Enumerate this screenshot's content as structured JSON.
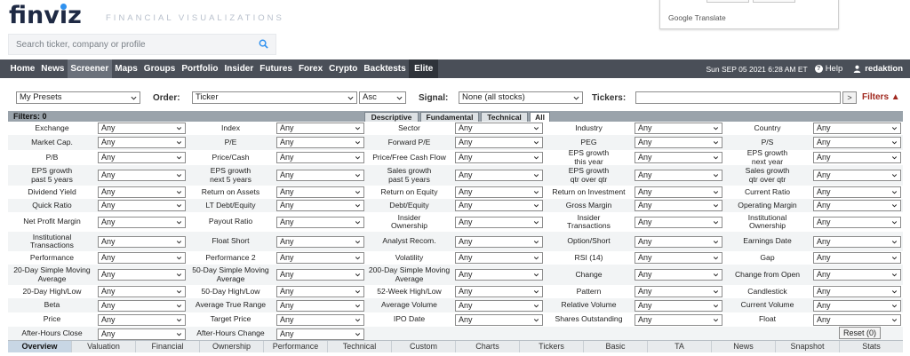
{
  "header": {
    "logo_text": "finviz",
    "tagline": "FINANCIAL VISUALIZATIONS",
    "search_placeholder": "Search ticker, company or profile",
    "translate_label": "Google Translate"
  },
  "nav": {
    "items": [
      "Home",
      "News",
      "Screener",
      "Maps",
      "Groups",
      "Portfolio",
      "Insider",
      "Futures",
      "Forex",
      "Crypto",
      "Backtests",
      "Elite"
    ],
    "active": "Screener",
    "datetime": "Sun SEP 05 2021 6:28 AM ET",
    "help": "Help",
    "user": "redaktion"
  },
  "controls": {
    "presets_value": "My Presets",
    "order_label": "Order:",
    "order_value": "Ticker",
    "direction_value": "Asc",
    "signal_label": "Signal:",
    "signal_value": "None (all stocks)",
    "tickers_label": "Tickers:",
    "go_label": ">",
    "filters_toggle": "Filters ▲"
  },
  "filter_header": {
    "count_label": "Filters: 0",
    "tabs": [
      "Descriptive",
      "Fundamental",
      "Technical",
      "All"
    ],
    "active_tab": "All"
  },
  "filter_default_value": "Any",
  "filter_rows": [
    [
      "Exchange",
      "Index",
      "Sector",
      "Industry",
      "Country"
    ],
    [
      "Market Cap.",
      "P/E",
      "Forward P/E",
      "PEG",
      "P/S"
    ],
    [
      "P/B",
      "Price/Cash",
      "Price/Free Cash Flow",
      "EPS growth\nthis year",
      "EPS growth\nnext year"
    ],
    [
      "EPS growth\npast 5 years",
      "EPS growth\nnext 5 years",
      "Sales growth\npast 5 years",
      "EPS growth\nqtr over qtr",
      "Sales growth\nqtr over qtr"
    ],
    [
      "Dividend Yield",
      "Return on Assets",
      "Return on Equity",
      "Return on Investment",
      "Current Ratio"
    ],
    [
      "Quick Ratio",
      "LT Debt/Equity",
      "Debt/Equity",
      "Gross Margin",
      "Operating Margin"
    ],
    [
      "Net Profit Margin",
      "Payout Ratio",
      "Insider\nOwnership",
      "Insider\nTransactions",
      "Institutional\nOwnership"
    ],
    [
      "Institutional\nTransactions",
      "Float Short",
      "Analyst Recom.",
      "Option/Short",
      "Earnings Date"
    ],
    [
      "Performance",
      "Performance 2",
      "Volatility",
      "RSI (14)",
      "Gap"
    ],
    [
      "20-Day Simple Moving\nAverage",
      "50-Day Simple Moving\nAverage",
      "200-Day Simple Moving\nAverage",
      "Change",
      "Change from Open"
    ],
    [
      "20-Day High/Low",
      "50-Day High/Low",
      "52-Week High/Low",
      "Pattern",
      "Candlestick"
    ],
    [
      "Beta",
      "Average True Range",
      "Average Volume",
      "Relative Volume",
      "Current Volume"
    ],
    [
      "Price",
      "Target Price",
      "IPO Date",
      "Shares Outstanding",
      "Float"
    ],
    [
      "After-Hours Close",
      "After-Hours Change"
    ]
  ],
  "reset_label": "Reset (0)",
  "view_tabs": [
    "Overview",
    "Valuation",
    "Financial",
    "Ownership",
    "Performance",
    "Technical",
    "Custom",
    "Charts",
    "Tickers",
    "Basic",
    "TA",
    "News",
    "Snapshot",
    "Stats"
  ],
  "active_view": "Overview",
  "colors": {
    "nav_bg": "#4a4f58",
    "filters_bar": "#9aa3ab",
    "accent_red": "#a0281e",
    "logo_blue": "#2f91ef"
  }
}
